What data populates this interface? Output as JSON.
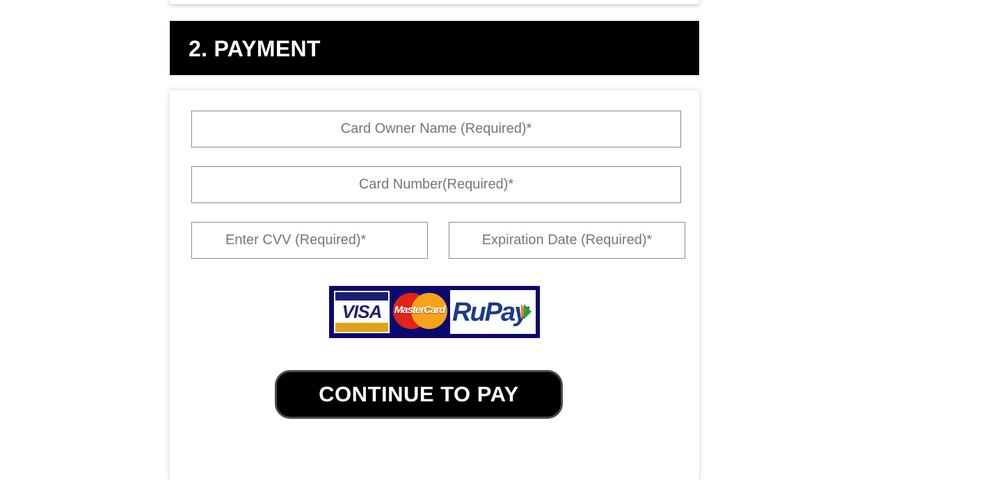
{
  "section": {
    "title": "2. PAYMENT"
  },
  "form": {
    "card_owner_placeholder": "Card Owner Name (Required)*",
    "card_number_placeholder": "Card Number(Required)*",
    "cvv_placeholder": "Enter CVV (Required)*",
    "expiration_placeholder": "Expiration Date (Required)*"
  },
  "card_logos": {
    "visa": "VISA",
    "mastercard": "MasterCard",
    "rupay": "RuPay"
  },
  "actions": {
    "pay_label": "CONTINUE TO PAY"
  },
  "colors": {
    "header_bg": "#000000",
    "header_text": "#ffffff",
    "button_bg": "#000000",
    "logo_bg": "#0a0a6e"
  }
}
